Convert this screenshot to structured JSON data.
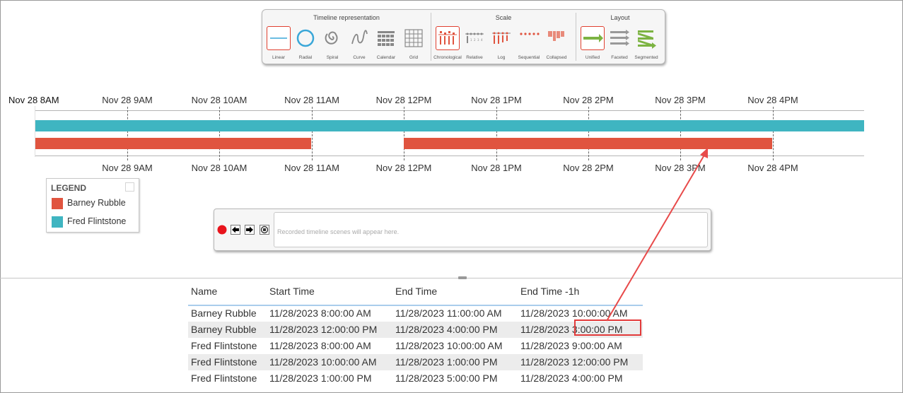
{
  "toolbar": {
    "sections": [
      {
        "title": "Timeline representation",
        "items": [
          "Linear",
          "Radial",
          "Spiral",
          "Curve",
          "Calendar",
          "Grid"
        ]
      },
      {
        "title": "Scale",
        "items": [
          "Chronological",
          "Relative",
          "Log",
          "Sequential",
          "Collapsed"
        ]
      },
      {
        "title": "Layout",
        "items": [
          "Unified",
          "Faceted",
          "Segmented"
        ]
      }
    ]
  },
  "timeline": {
    "first_label": "Nov 28 8AM",
    "top_ticks": [
      "Nov 28 9AM",
      "Nov 28 10AM",
      "Nov 28 11AM",
      "Nov 28 12PM",
      "Nov 28 1PM",
      "Nov 28 2PM",
      "Nov 28 3PM",
      "Nov 28 4PM"
    ],
    "bottom_ticks": [
      "Nov 28 9AM",
      "Nov 28 10AM",
      "Nov 28 11AM",
      "Nov 28 12PM",
      "Nov 28 1PM",
      "Nov 28 2PM",
      "Nov 28 3PM",
      "Nov 28 4PM"
    ],
    "colors": {
      "barney": "#e0543f",
      "fred": "#3fb5c1"
    }
  },
  "legend": {
    "title": "LEGEND",
    "items": [
      {
        "label": "Barney Rubble",
        "color": "#e0543f"
      },
      {
        "label": "Fred Flintstone",
        "color": "#3fb5c1"
      }
    ]
  },
  "recorder": {
    "placeholder": "Recorded timeline scenes will appear here.",
    "controls": [
      "record-icon",
      "arrow-left-icon",
      "arrow-right-icon",
      "stop-icon"
    ]
  },
  "table": {
    "headers": [
      "Name",
      "Start Time",
      "End Time",
      "End Time -1h"
    ],
    "rows": [
      [
        "Barney Rubble",
        "11/28/2023 8:00:00 AM",
        "11/28/2023 11:00:00 AM",
        "11/28/2023 10:00:00 AM"
      ],
      [
        "Barney Rubble",
        "11/28/2023 12:00:00 PM",
        "11/28/2023 4:00:00 PM",
        "11/28/2023 3:00:00 PM"
      ],
      [
        "Fred Flintstone",
        "11/28/2023 8:00:00 AM",
        "11/28/2023 10:00:00 AM",
        "11/28/2023 9:00:00 AM"
      ],
      [
        "Fred Flintstone",
        "11/28/2023 10:00:00 AM",
        "11/28/2023 1:00:00 PM",
        "11/28/2023 12:00:00 PM"
      ],
      [
        "Fred Flintstone",
        "11/28/2023 1:00:00 PM",
        "11/28/2023 5:00:00 PM",
        "11/28/2023 4:00:00 PM"
      ]
    ]
  }
}
